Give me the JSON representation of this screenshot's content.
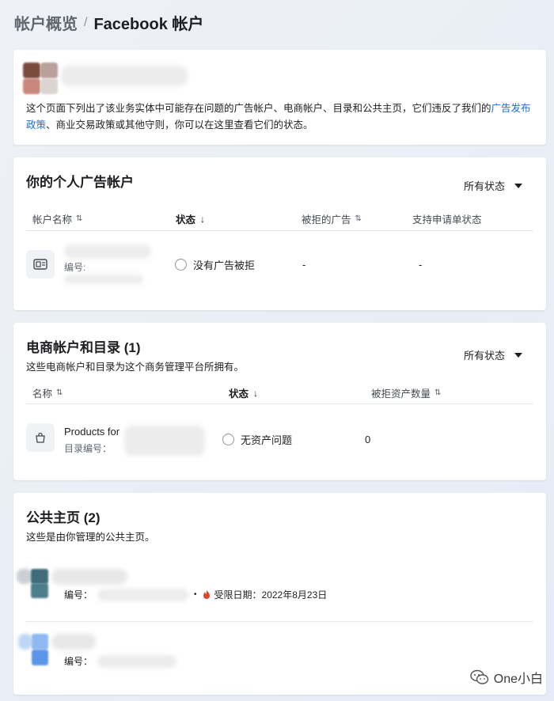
{
  "breadcrumb": {
    "parent": "帐户概览",
    "separator": "/",
    "current": "Facebook 帐户"
  },
  "entity": {
    "description_part1": "这个页面下列出了该业务实体中可能存在问题的广告帐户、电商帐户、目录和公共主页，它们违反了我们的",
    "policy_link": "广告发布政策",
    "description_part2": "、商业交易政策或其他守则，你可以在这里查看它们的状态。"
  },
  "ad_accounts": {
    "title": "你的个人广告帐户",
    "filter": "所有状态",
    "columns": [
      "帐户名称",
      "状态",
      "被拒的广告",
      "支持申请单状态"
    ],
    "rows": [
      {
        "id_label": "编号:",
        "status": "没有广告被拒",
        "rejected_ads": "-",
        "support_status": "-"
      }
    ]
  },
  "commerce": {
    "title": "电商帐户和目录 (1)",
    "subtitle": "这些电商帐户和目录为这个商务管理平台所拥有。",
    "filter": "所有状态",
    "columns": [
      "名称",
      "状态",
      "被拒资产数量"
    ],
    "rows": [
      {
        "name": "Products for",
        "catalog_label": "目录编号：",
        "status": "无资产问题",
        "rejected_count": "0"
      }
    ]
  },
  "pages": {
    "title": "公共主页 (2)",
    "subtitle": "这些是由你管理的公共主页。",
    "rows": [
      {
        "id_label": "编号：",
        "restricted": "受限日期：2022年8月23日"
      },
      {
        "id_label": "编号："
      }
    ]
  },
  "watermark": "One小白",
  "colors": {
    "link": "#216fdb",
    "warning": "#e0452b"
  }
}
